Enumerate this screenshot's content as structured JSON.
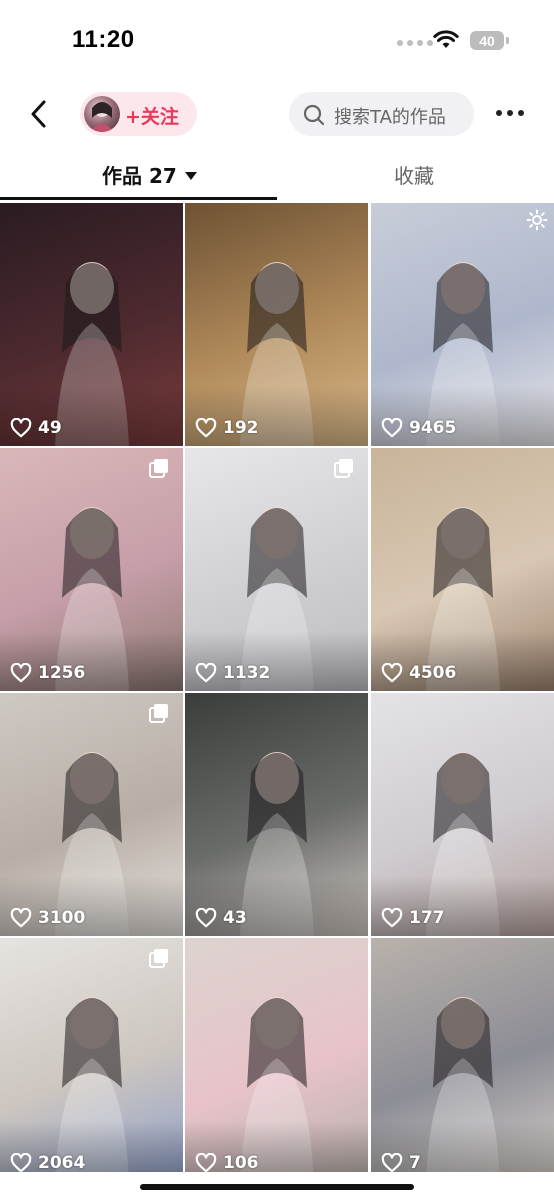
{
  "status_bar": {
    "time": "11:20",
    "battery": "40"
  },
  "header": {
    "follow_label": "+关注",
    "search_placeholder": "搜索TA的作品"
  },
  "tabs": [
    {
      "label": "作品 27",
      "active": true
    },
    {
      "label": "收藏",
      "active": false
    }
  ],
  "posts": [
    {
      "likes": "49",
      "multi_image": false,
      "colors": [
        "#2a1c22",
        "#4d2a2f",
        "#7a3b3b"
      ]
    },
    {
      "likes": "192",
      "multi_image": false,
      "colors": [
        "#6e5234",
        "#b08a5a",
        "#d9b88a"
      ]
    },
    {
      "likes": "9465",
      "multi_image": false,
      "colors": [
        "#c8cdd8",
        "#aeb7cc",
        "#e8e6ea"
      ]
    },
    {
      "likes": "1256",
      "multi_image": true,
      "colors": [
        "#d9b7b9",
        "#c69ea8",
        "#8e7a74"
      ]
    },
    {
      "likes": "1132",
      "multi_image": true,
      "colors": [
        "#e7e6e8",
        "#cfcfd2",
        "#bdbdc2"
      ]
    },
    {
      "likes": "4506",
      "multi_image": false,
      "colors": [
        "#c9b49a",
        "#d8c7b3",
        "#9c8470"
      ]
    },
    {
      "likes": "3100",
      "multi_image": true,
      "colors": [
        "#cfc9c3",
        "#b7aea6",
        "#e6e1dc"
      ]
    },
    {
      "likes": "43",
      "multi_image": false,
      "colors": [
        "#3b3d3a",
        "#6a6c6a",
        "#cfc7c2"
      ]
    },
    {
      "likes": "177",
      "multi_image": false,
      "colors": [
        "#e3e3e6",
        "#cfcbd0",
        "#b6a3a0"
      ]
    },
    {
      "likes": "2064",
      "multi_image": true,
      "colors": [
        "#e6e3e0",
        "#cdc6c0",
        "#8fa0c8"
      ]
    },
    {
      "likes": "106",
      "multi_image": false,
      "colors": [
        "#dcd3cf",
        "#e7c3c9",
        "#b8b0ad"
      ]
    },
    {
      "likes": "7",
      "multi_image": false,
      "colors": [
        "#b9b2ab",
        "#8d8d96",
        "#d4cfc9"
      ]
    }
  ]
}
